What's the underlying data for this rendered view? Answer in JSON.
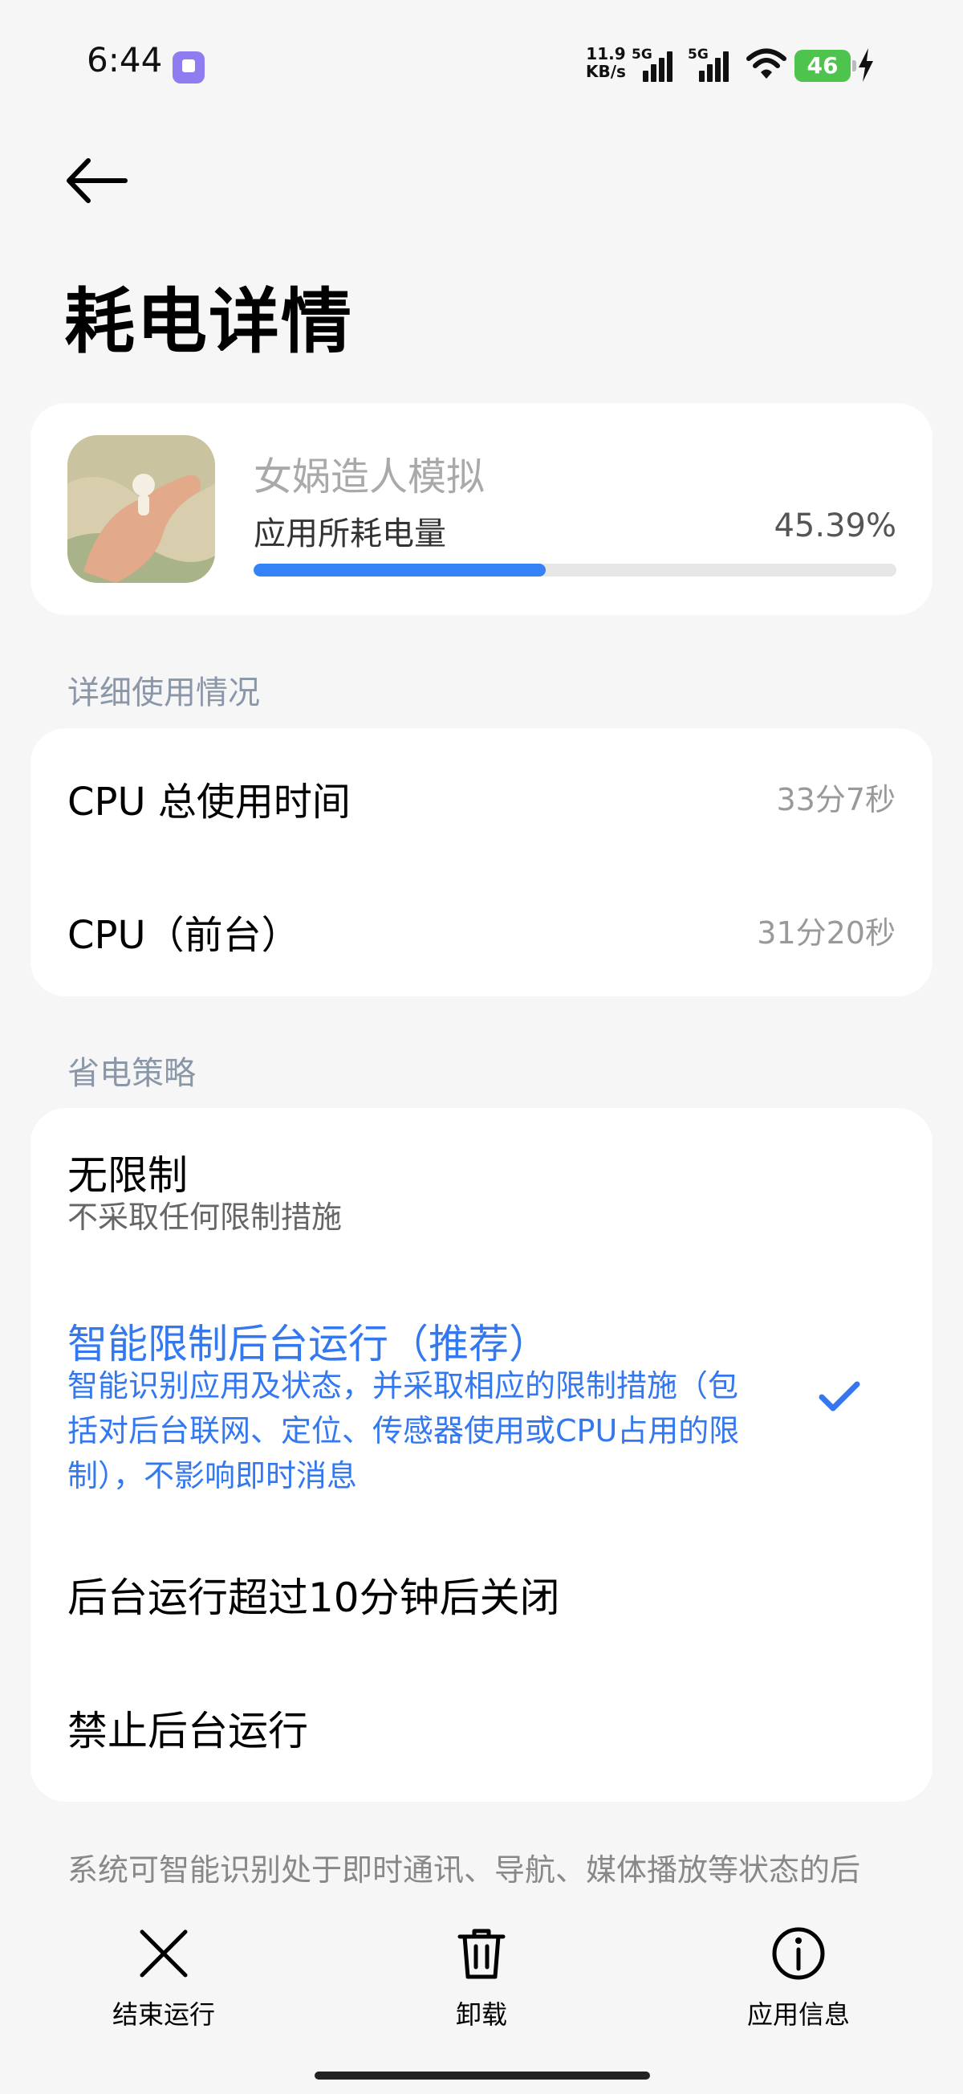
{
  "status_bar": {
    "time": "6:44",
    "net_speed_value": "11.9",
    "net_speed_unit": "KB/s",
    "sim1_tag": "5G",
    "sim2_tag": "5G",
    "battery": "46"
  },
  "header": {
    "title": "耗电详情"
  },
  "app": {
    "name": "女娲造人模拟",
    "usage_label": "应用所耗电量",
    "usage_value": "45.39%",
    "usage_percent": 45.39
  },
  "details": {
    "header": "详细使用情况",
    "rows": [
      {
        "label": "CPU 总使用时间",
        "value": "33分7秒"
      },
      {
        "label": "CPU（前台）",
        "value": "31分20秒"
      }
    ]
  },
  "policy": {
    "header": "省电策略",
    "options": [
      {
        "title": "无限制",
        "desc": "不采取任何限制措施"
      },
      {
        "title": "智能限制后台运行（推荐）",
        "desc_lines": [
          "智能识别应用及状态，并采取相应的限制措施（包",
          "括对后台联网、定位、传感器使用或CPU占用的限",
          "制），不影响即时消息"
        ]
      },
      {
        "title": "后台运行超过10分钟后关闭"
      },
      {
        "title": "禁止后台运行"
      }
    ],
    "selected": 1
  },
  "footer_note": "系统可智能识别处于即时通讯、导航、媒体播放等状态的后",
  "actions": [
    {
      "label": "结束运行",
      "icon": "close-icon"
    },
    {
      "label": "卸载",
      "icon": "trash-icon"
    },
    {
      "label": "应用信息",
      "icon": "info-icon"
    }
  ],
  "colors": {
    "accent": "#3478f0",
    "progress": "#3482f6",
    "battery": "#4ec34e"
  }
}
